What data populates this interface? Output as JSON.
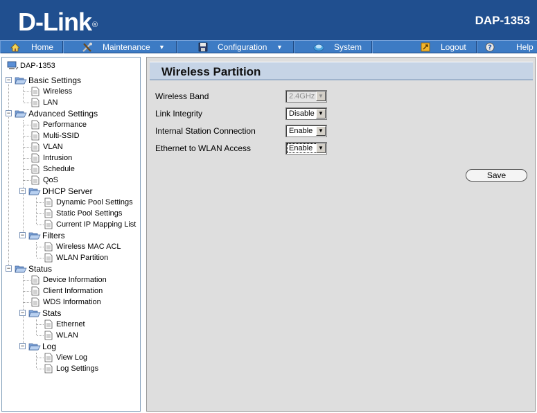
{
  "header": {
    "brand": "D-Link",
    "trademark": "®",
    "model": "DAP-1353"
  },
  "nav": [
    {
      "label": "Home",
      "icon": "home-icon"
    },
    {
      "label": "Maintenance",
      "icon": "tools-icon",
      "dropdown": "▼"
    },
    {
      "label": "Configuration",
      "icon": "floppy-disk-icon",
      "dropdown": "▼"
    },
    {
      "label": "System",
      "icon": "system-icon"
    },
    {
      "label": "Logout",
      "icon": "logout-icon"
    },
    {
      "label": "Help",
      "icon": "help-icon"
    }
  ],
  "tree": {
    "root": "DAP-1353",
    "basic": {
      "label": "Basic Settings",
      "items": [
        "Wireless",
        "LAN"
      ]
    },
    "advanced": {
      "label": "Advanced Settings",
      "items": [
        "Performance",
        "Multi-SSID",
        "VLAN",
        "Intrusion",
        "Schedule",
        "QoS"
      ]
    },
    "dhcp": {
      "label": "DHCP Server",
      "items": [
        "Dynamic Pool Settings",
        "Static Pool Settings",
        "Current IP Mapping List"
      ]
    },
    "filters": {
      "label": "Filters",
      "items": [
        "Wireless MAC ACL",
        "WLAN Partition"
      ]
    },
    "status": {
      "label": "Status",
      "items": [
        "Device Information",
        "Client Information",
        "WDS Information"
      ]
    },
    "stats": {
      "label": "Stats",
      "items": [
        "Ethernet",
        "WLAN"
      ]
    },
    "log": {
      "label": "Log",
      "items": [
        "View Log",
        "Log Settings"
      ]
    }
  },
  "main": {
    "title": "Wireless Partition",
    "fields": [
      {
        "label": "Wireless Band",
        "value": "2.4GHz",
        "disabled": true
      },
      {
        "label": "Link Integrity",
        "value": "Disable"
      },
      {
        "label": "Internal Station Connection",
        "value": "Enable"
      },
      {
        "label": "Ethernet to WLAN Access",
        "value": "Enable",
        "focused": true
      }
    ],
    "save_label": "Save"
  },
  "colors": {
    "header_bg": "#204f8f",
    "nav_bg": "#3d7bc4",
    "title_bg": "#c6d4e6",
    "content_bg": "#dedede"
  }
}
